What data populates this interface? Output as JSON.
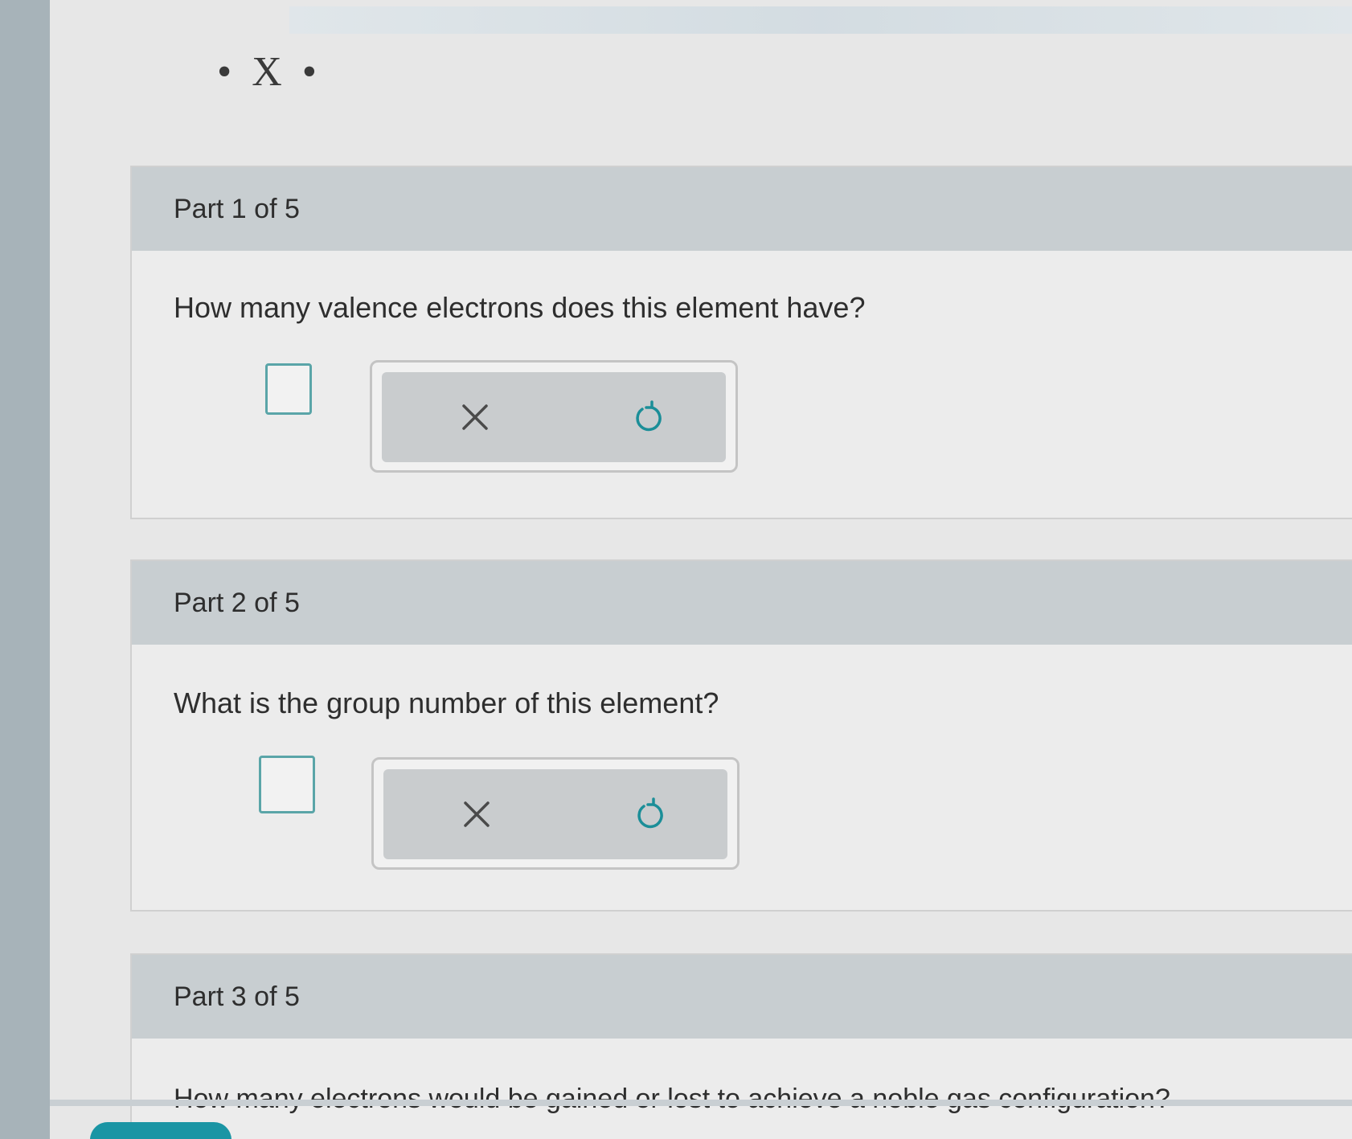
{
  "lewis_symbol": "• X •",
  "parts": [
    {
      "header": "Part 1 of 5",
      "question": "How many valence electrons does this element have?"
    },
    {
      "header": "Part 2 of 5",
      "question": "What is the group number of this element?"
    },
    {
      "header": "Part 3 of 5",
      "question": "How many electrons would be gained or lost to achieve a noble gas configuration?"
    }
  ],
  "icons": {
    "clear": "close-icon",
    "undo": "undo-icon"
  },
  "colors": {
    "accent": "#1a95a4",
    "answer_border": "#5aa5a8",
    "header_bg": "#c8ced1"
  }
}
